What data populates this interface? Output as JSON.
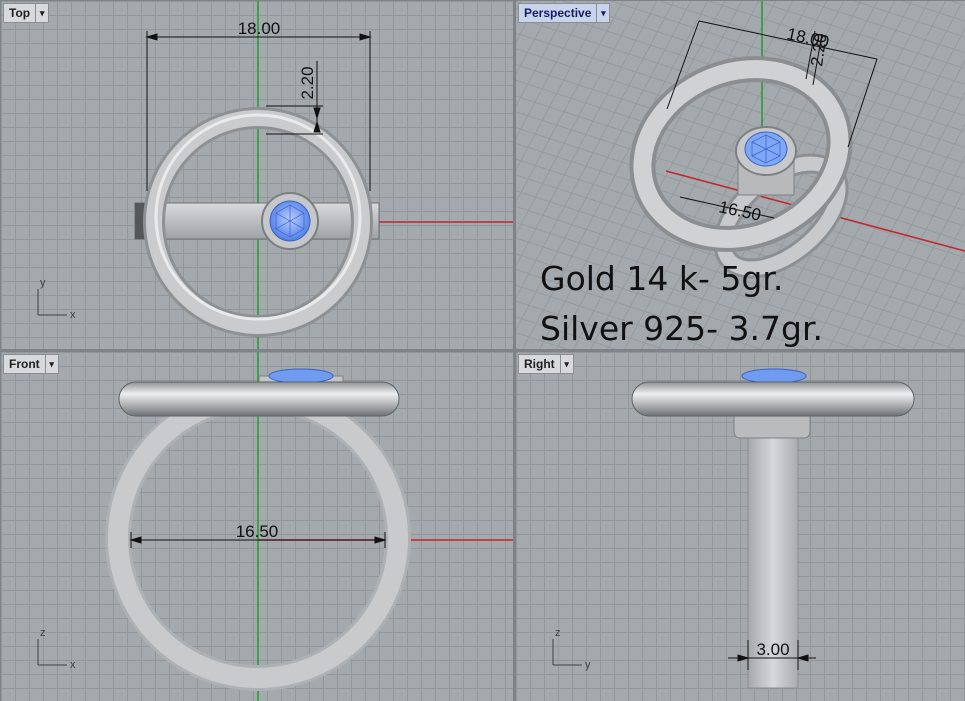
{
  "viewports": {
    "top": {
      "label": "Top",
      "axis_v": "y",
      "axis_h": "x",
      "dims": {
        "width": "18.00",
        "height": "2.20"
      }
    },
    "persp": {
      "label": "Perspective",
      "dims": {
        "width": "18.00",
        "height": "2.20",
        "shank": "16.50"
      },
      "weights": {
        "gold": "Gold 14 k- 5gr.",
        "silver": "Silver 925- 3.7gr."
      }
    },
    "front": {
      "label": "Front",
      "axis_v": "z",
      "axis_h": "x",
      "dims": {
        "inner": "16.50"
      }
    },
    "right": {
      "label": "Right",
      "axis_v": "z",
      "axis_h": "y",
      "dims": {
        "band": "3.00"
      }
    }
  },
  "dropdown_glyph": "▾",
  "colors": {
    "metal": "#c8cacc",
    "metal_dark": "#8a8c8f",
    "gem": "#6f9cf0",
    "axis_green": "#1e9e2e",
    "axis_red": "#c0262a",
    "grid": "#a4a9ae"
  }
}
